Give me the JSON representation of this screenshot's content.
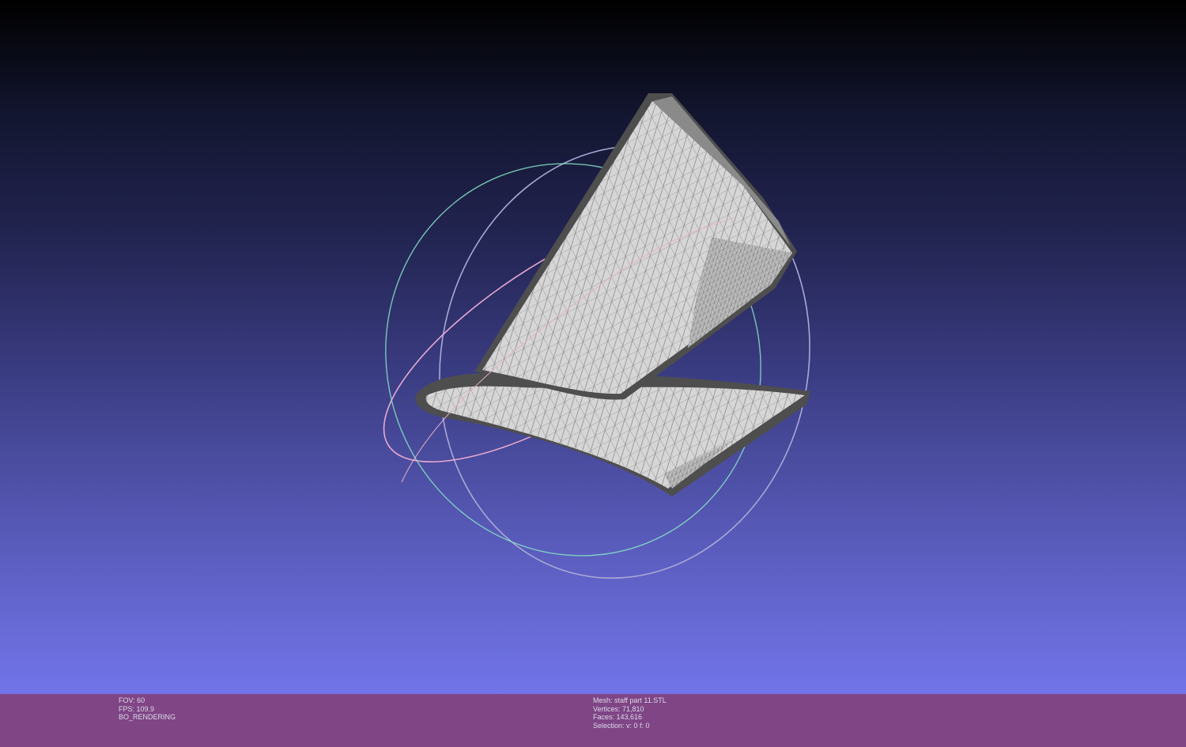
{
  "viewport": {
    "background_top": "#000000",
    "background_bottom": "#7174e8",
    "mesh_fill": "#d9d9d9",
    "mesh_edge": "#5a5a5a",
    "trackball_colors": [
      "#a8a8d8",
      "#7fe3c8",
      "#e8a0c8"
    ]
  },
  "status_left": {
    "fov": "FOV: 60",
    "fps": "FPS:   109.9",
    "mode": "BO_RENDERING"
  },
  "status_mesh": {
    "mesh": "Mesh: staff part 11.STL",
    "vertices": "Vertices: 71,810",
    "faces": "Faces: 143,616",
    "selection": "Selection: v: 0 f: 0"
  },
  "status_bar_color": "#7f4585"
}
